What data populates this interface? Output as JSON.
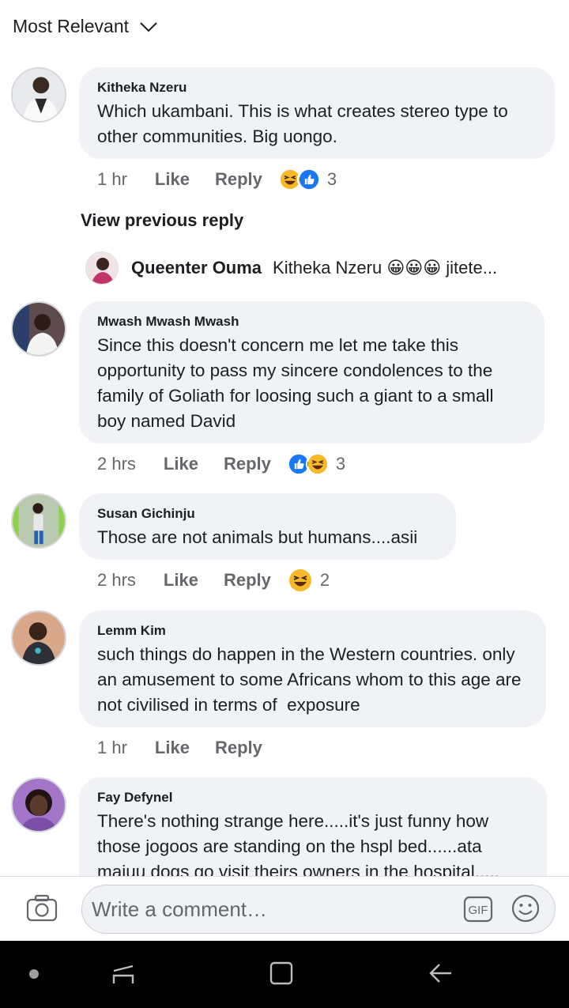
{
  "sort": {
    "label": "Most Relevant"
  },
  "comments": [
    {
      "author": "Kitheka Nzeru",
      "text": "Which ukambani. This is what creates stereo type to other communities. Big uongo.",
      "time": "1 hr",
      "like": "Like",
      "reply": "Reply",
      "reactions": [
        "haha",
        "like"
      ],
      "reaction_count": "3"
    },
    {
      "author": "Mwash Mwash Mwash",
      "text": "Since this doesn't concern me let me take this opportunity to pass my sincere condolences to the family of Goliath for loosing such a giant to a small boy named David",
      "time": "2 hrs",
      "like": "Like",
      "reply": "Reply",
      "reactions": [
        "like",
        "haha"
      ],
      "reaction_count": "3"
    },
    {
      "author": "Susan Gichinju",
      "text": "Those are not animals but humans....asii",
      "time": "2 hrs",
      "like": "Like",
      "reply": "Reply",
      "reactions": [
        "haha"
      ],
      "reaction_count": "2"
    },
    {
      "author": "Lemm Kim",
      "text": "such things do happen in the Western countries. only an amusement to some Africans whom to this age are not civilised in terms of  exposure",
      "time": "1 hr",
      "like": "Like",
      "reply": "Reply",
      "reactions": [],
      "reaction_count": ""
    },
    {
      "author": "Fay Defynel",
      "text": "There's nothing strange here.....it's just funny how those jogoos are standing on the hspl bed......ata majuu dogs go visit theirs owners in the hospital.....",
      "time": "",
      "like": "",
      "reply": "",
      "reactions": [],
      "reaction_count": ""
    }
  ],
  "view_previous_reply": "View previous reply",
  "reply_preview": {
    "author": "Queenter Ouma",
    "text": "Kitheka Nzeru 😀😀😀 jitete..."
  },
  "composer": {
    "placeholder": "Write a comment…",
    "gif_label": "GIF"
  },
  "colors": {
    "bubble": "#f0f2f5",
    "secondary_text": "#65676b",
    "primary_text": "#1c1e21",
    "like_blue": "#1877f2",
    "haha_yellow": "#f7b928"
  }
}
